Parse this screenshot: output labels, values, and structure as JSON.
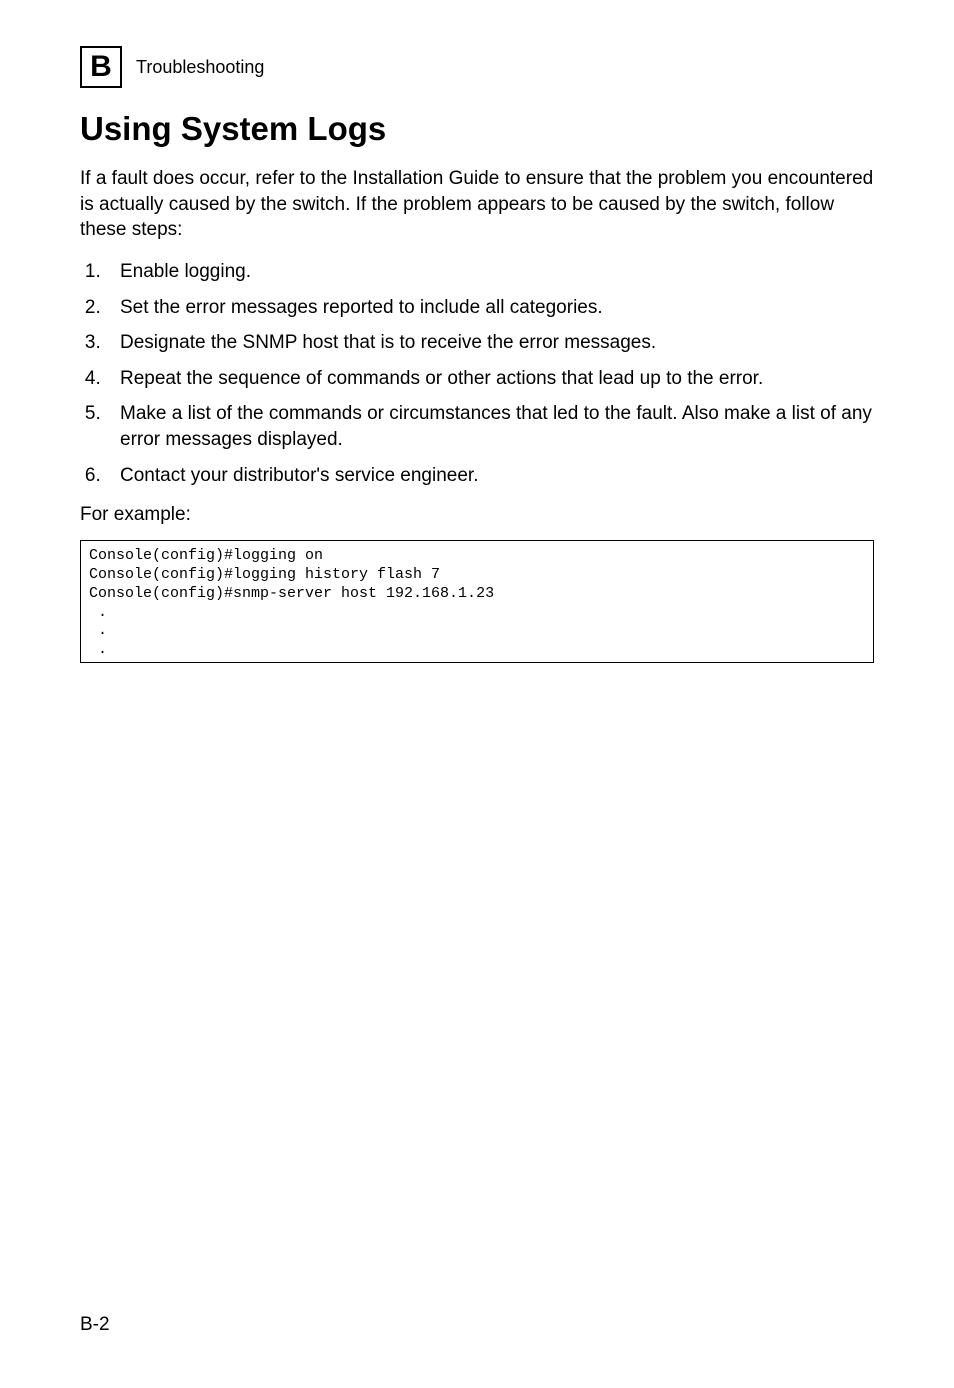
{
  "header": {
    "badge_letter": "B",
    "section": "Troubleshooting"
  },
  "title": "Using System Logs",
  "intro": "If a fault does occur, refer to the Installation Guide to ensure that the problem you encountered is actually caused by the switch. If the problem appears to be caused by the switch, follow these steps:",
  "steps": [
    "Enable logging.",
    "Set the error messages reported to include all categories.",
    "Designate the SNMP host that is to receive the error messages.",
    "Repeat the sequence of commands or other actions that lead up to the error.",
    "Make a list of the commands or circumstances that led to the fault. Also make a list of any error messages displayed.",
    "Contact your distributor's service engineer."
  ],
  "for_example_label": "For example:",
  "code_block": "Console(config)#logging on\nConsole(config)#logging history flash 7\nConsole(config)#snmp-server host 192.168.1.23\n .\n .\n .",
  "page_number": "B-2"
}
